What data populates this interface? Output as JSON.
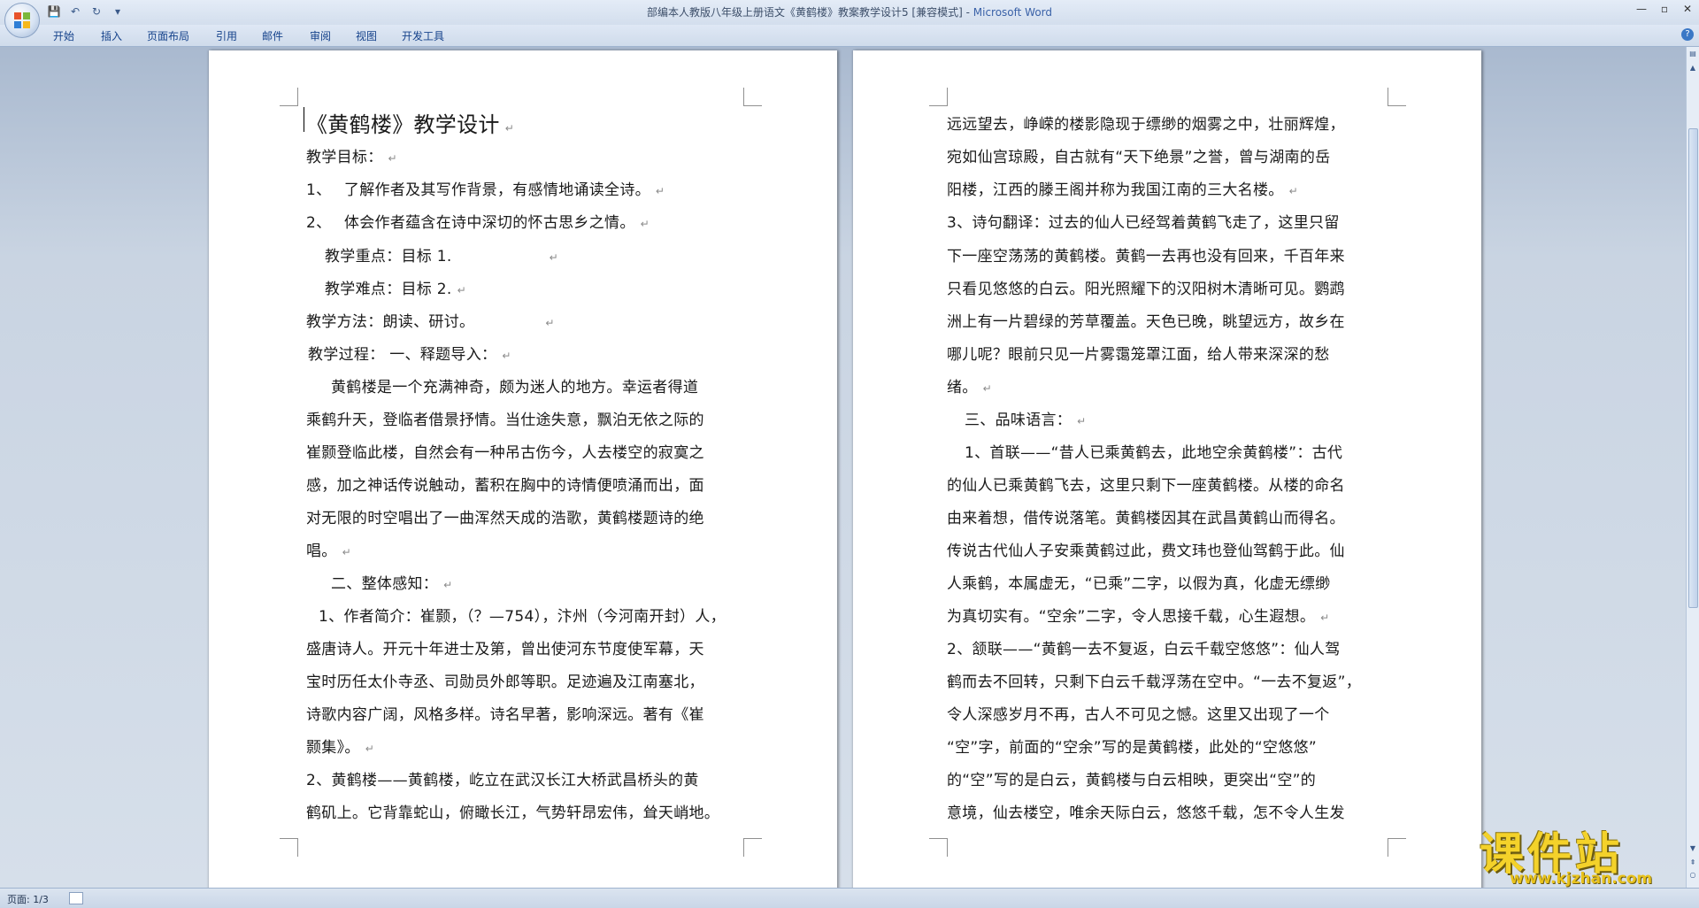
{
  "window": {
    "title_doc": "部编本人教版八年级上册语文《黄鹤楼》教案教学设计5 [兼容模式] - ",
    "title_app": "Microsoft Word",
    "min": "—",
    "max": "▫",
    "close": "✕"
  },
  "qat": {
    "save": "💾",
    "undo": "↶",
    "redo": "↻",
    "more": "▾"
  },
  "ribbon": {
    "tabs": [
      "开始",
      "插入",
      "页面布局",
      "引用",
      "邮件",
      "审阅",
      "视图",
      "开发工具"
    ],
    "help": "?"
  },
  "page1": {
    "lines": [
      "《黄鹤楼》教学设计",
      "教学目标：",
      "1、　 了解作者及其写作背景，有感情地诵读全诗。",
      "2、　 体会作者蕴含在诗中深切的怀古思乡之情。",
      "教学重点：目标 1.",
      "教学难点：目标 2.",
      "教学方法：朗读、研讨。",
      "教学过程：  一、释题导入：",
      "黄鹤楼是一个充满神奇，颇为迷人的地方。幸运者得道",
      "乘鹤升天，登临者借景抒情。当仕途失意，飘泊无依之际的",
      "崔颢登临此楼，自然会有一种吊古伤今，人去楼空的寂寞之",
      "感，加之神话传说触动，蓄积在胸中的诗情便喷涌而出，面",
      "对无限的时空唱出了一曲浑然天成的浩歌，黄鹤楼题诗的绝",
      "唱。",
      "二、整体感知：",
      "1、作者简介：崔颢，（？—754），汴州（今河南开封）人，",
      "盛唐诗人。开元十年进士及第，曾出使河东节度使军幕，天",
      "宝时历任太仆寺丞、司勋员外郎等职。足迹遍及江南塞北，",
      "诗歌内容广阔，风格多样。诗名早著，影响深远。著有《崔",
      "颢集》。",
      "2、黄鹤楼——黄鹤楼，屹立在武汉长江大桥武昌桥头的黄",
      "鹤矶上。它背靠蛇山，俯瞰长江，气势轩昂宏伟，耸天峭地。"
    ]
  },
  "page2": {
    "lines": [
      "远远望去，峥嵘的楼影隐现于缥缈的烟雾之中，壮丽辉煌，",
      "宛如仙宫琼殿，自古就有“天下绝景”之誉，曾与湖南的岳",
      "阳楼，江西的滕王阁并称为我国江南的三大名楼。",
      "3、诗句翻译：过去的仙人已经驾着黄鹤飞走了，这里只留",
      "下一座空荡荡的黄鹤楼。黄鹤一去再也没有回来，千百年来",
      "只看见悠悠的白云。阳光照耀下的汉阳树木清晰可见。鹦鹉",
      "洲上有一片碧绿的芳草覆盖。天色已晚，眺望远方，故乡在",
      "哪儿呢？眼前只见一片雾霭笼罩江面，给人带来深深的愁",
      "绪。",
      "三、品味语言：",
      "1、首联——“昔人已乘黄鹤去，此地空余黄鹤楼”：古代",
      "的仙人已乘黄鹤飞去，这里只剩下一座黄鹤楼。从楼的命名",
      "由来着想，借传说落笔。黄鹤楼因其在武昌黄鹤山而得名。",
      "传说古代仙人子安乘黄鹤过此，费文玮也登仙驾鹤于此。仙",
      "人乘鹤，本属虚无，“已乘”二字，以假为真，化虚无缥缈",
      "为真切实有。“空余”二字，令人思接千载，心生遐想。",
      "2、颔联——“黄鹤一去不复返，白云千载空悠悠”：仙人驾",
      "鹤而去不回转，只剩下白云千载浮荡在空中。“一去不复返”，",
      "令人深感岁月不再，古人不可见之憾。这里又出现了一个",
      "“空”字，前面的“空余”写的是黄鹤楼，此处的“空悠悠”",
      "的“空”写的是白云，黄鹤楼与白云相映，更突出“空”的",
      "意境，仙去楼空，唯余天际白云，悠悠千载，怎不令人生发"
    ]
  },
  "paragraph_mark": "↵",
  "status": {
    "page": "页面: 1/3"
  },
  "watermark": {
    "main": "课件站",
    "url": "www.kjzhan.com"
  }
}
